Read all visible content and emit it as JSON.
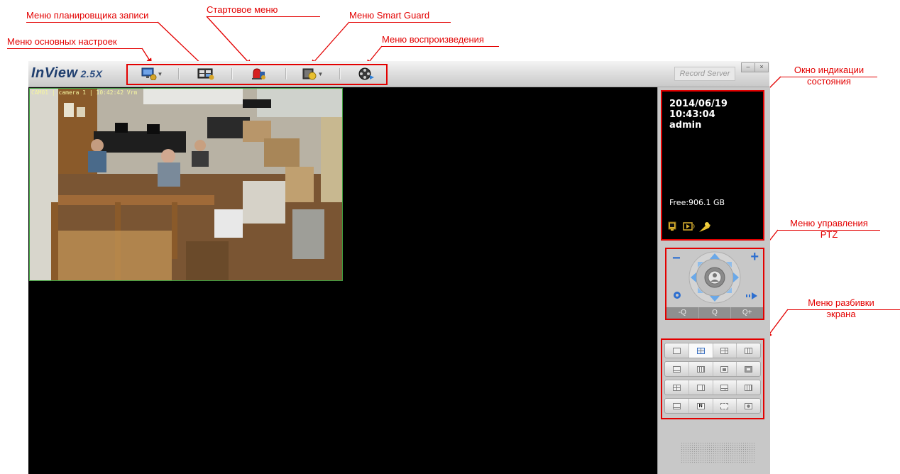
{
  "annotations": {
    "schedule_menu": "Меню планировщика записи",
    "main_settings_menu": "Меню основных настроек",
    "start_menu": "Стартовое меню",
    "smart_guard_menu": "Меню Smart Guard",
    "playback_menu": "Меню воспроизведения",
    "status_window_line1": "Окно индикации",
    "status_window_line2": "состояния",
    "ptz_menu_line1": "Меню управления",
    "ptz_menu_line2": "PTZ",
    "split_menu_line1": "Меню разбивки",
    "split_menu_line2": "экрана"
  },
  "app": {
    "logo": "InView",
    "version": "2.5X",
    "record_server": "Record Server",
    "minimize": "–",
    "close": "×"
  },
  "toolbar_icons": [
    "monitor-settings-icon",
    "schedule-icon",
    "alarm-icon",
    "smart-guard-icon",
    "playback-icon"
  ],
  "camera": {
    "label": "CAM01 | camera 1 | 10:42:42  Vrm"
  },
  "status": {
    "date": "2014/06/19",
    "time": "10:43:04",
    "user": "admin",
    "free": "Free:906.1 GB"
  },
  "ptz": {
    "minus": "−",
    "plus": "+",
    "zoom_out": "-Q",
    "zoom_reset": "Q",
    "zoom_in": "Q+"
  },
  "colors": {
    "annotation": "#e30000",
    "logo": "#1f3e6e",
    "ptz_blue": "#3a78c8"
  }
}
